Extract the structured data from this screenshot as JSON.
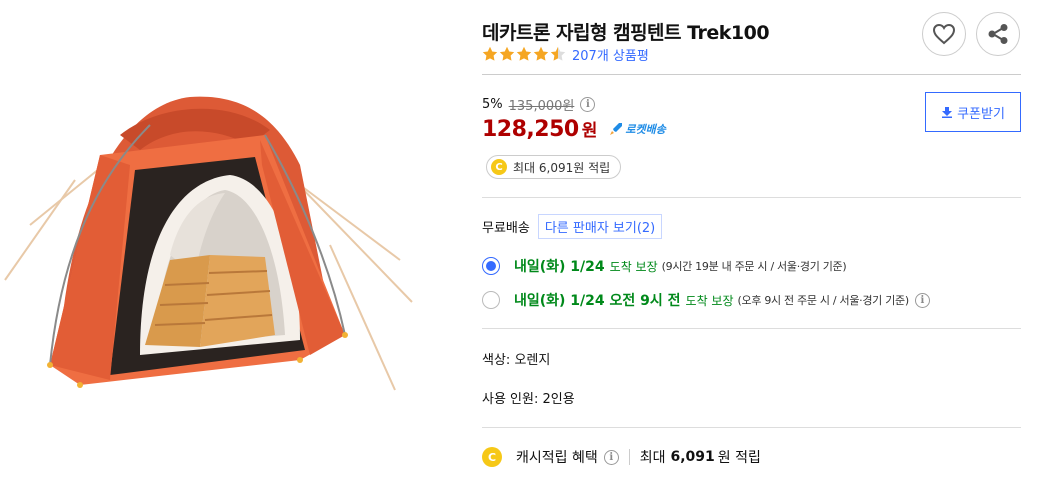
{
  "product": {
    "title": "데카트론 자립형 캠핑텐트 Trek100",
    "rating": 4.5,
    "rating_max": 5,
    "review_count": "207개 상품평",
    "image_icon": "orange-dome-tent-image"
  },
  "actions": {
    "wishlist_icon": "heart-icon",
    "share_icon": "share-icon",
    "coupon_label": "쿠폰받기"
  },
  "price": {
    "discount_rate": "5%",
    "original_price": "135,000원",
    "sale_price": "128,250",
    "currency": "원",
    "rocket_label": "로켓배송",
    "reward_label": "최대 6,091원 적립"
  },
  "shipping": {
    "label": "무료배송",
    "other_sellers": "다른 판매자 보기(2)"
  },
  "delivery_options": [
    {
      "date": "내일(화) 1/24",
      "text": "도착 보장",
      "note": "(9시간 19분 내 주문 시 / 서울·경기 기준)",
      "selected": true
    },
    {
      "date": "내일(화) 1/24 오전 9시 전",
      "text": "도착 보장",
      "note": "(오후 9시 전 주문 시 / 서울·경기 기준)",
      "selected": false
    }
  ],
  "attributes": {
    "color_label": "색상:",
    "color_value": "오렌지",
    "people_label": "사용 인원:",
    "people_value": "2인용"
  },
  "cash": {
    "label": "캐시적립 혜택",
    "prefix": "최대",
    "amount": "6,091",
    "suffix": "원 적립"
  },
  "colors": {
    "price_red": "#ae0000",
    "link_blue": "#346aff",
    "delivery_green": "#00891a",
    "star_orange": "#f5a623",
    "coin_yellow": "#f6c817",
    "tent_orange": "#e8643c"
  }
}
